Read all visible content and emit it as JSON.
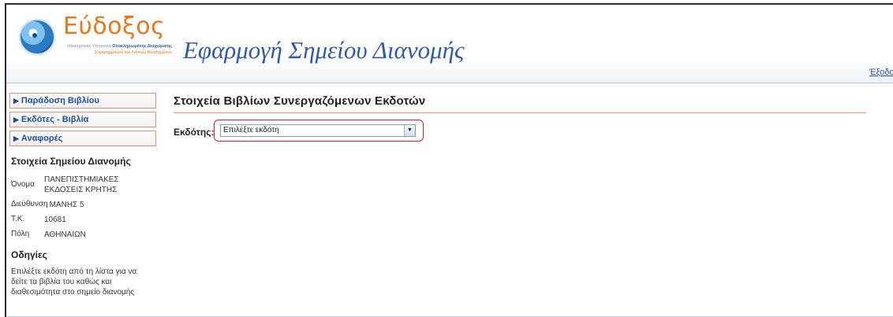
{
  "header": {
    "logo": {
      "word": "Εύδοξος",
      "subtitle_line1_prefix": "Ηλεκτρονική Υπηρεσία",
      "subtitle_line1_bold": "Ολοκληρωμένης Διαχείρισης",
      "subtitle_line2": "Συγγραμμάτων και Λοιπών Βοηθημάτων"
    },
    "app_title": "Εφαρμογή Σημείου Διανομής",
    "exit_link": "Έξοδος"
  },
  "sidebar": {
    "menu": [
      {
        "label": "Παράδοση Βιβλίου"
      },
      {
        "label": "Εκδότες - Βιβλία"
      },
      {
        "label": "Αναφορές"
      }
    ],
    "point_heading": "Στοιχεία Σημείου Διανομής",
    "point_info": {
      "name_label": "Όνομα",
      "name_value": "ΠΑΝΕΠΙΣΤΗΜΙΑΚΕΣ ΕΚΔΟΣΕΙΣ ΚΡΗΤΗΣ",
      "address_label": "Διεύθυνση",
      "address_value": "ΜΑΝΗΣ 5",
      "postcode_label": "Τ.Κ.",
      "postcode_value": "10681",
      "city_label": "Πόλη",
      "city_value": "ΑΘΗΝΑΙΩΝ"
    },
    "instructions_heading": "Οδηγίες",
    "instructions_text": "Επιλέξτε εκδότη από τη λίστα για να δείτε τα βιβλία του καθώς και διαθεσιμότητα στο σημείο διανομής"
  },
  "main": {
    "title": "Στοιχεία Βιβλίων Συνεργαζόμενων Εκδοτών",
    "publisher_label": "Εκδότης:",
    "publisher_select_value": "Επιλέξτε εκδότη"
  },
  "colors": {
    "accent_orange": "#e8781e",
    "title_blue": "#2f5aa8",
    "menu_border": "#e2907b",
    "highlight_red": "#d21e2e"
  }
}
